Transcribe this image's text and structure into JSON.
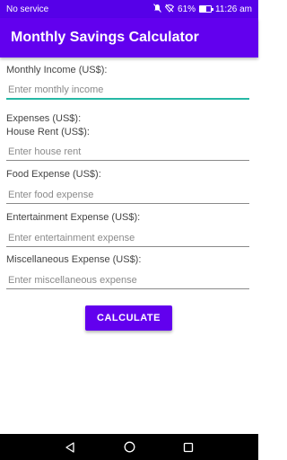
{
  "status_bar": {
    "carrier": "No service",
    "battery": "61%",
    "time": "11:26 am",
    "battery_level": 0.61,
    "icons": [
      "mute-icon",
      "wifi-off-icon",
      "battery-icon"
    ]
  },
  "app_bar": {
    "title": "Monthly Savings Calculator",
    "color": "#6200ee"
  },
  "form": {
    "monthly_income_label": "Monthly Income (US$):",
    "monthly_income_placeholder": "Enter monthly income",
    "expenses_heading": "Expenses (US$):",
    "house_rent_label": "House Rent (US$):",
    "house_rent_placeholder": "Enter house rent",
    "food_label": "Food Expense (US$):",
    "food_placeholder": "Enter food expense",
    "entertainment_label": "Entertainment Expense (US$):",
    "entertainment_placeholder": "Enter entertainment expense",
    "misc_label": "Miscellaneous Expense (US$):",
    "misc_placeholder": "Enter miscellaneous expense",
    "calculate_label": "CALCULATE",
    "accent_color": "#26b8a5"
  },
  "nav_bar": {
    "icons": [
      "back-icon",
      "home-icon",
      "recents-icon"
    ]
  }
}
